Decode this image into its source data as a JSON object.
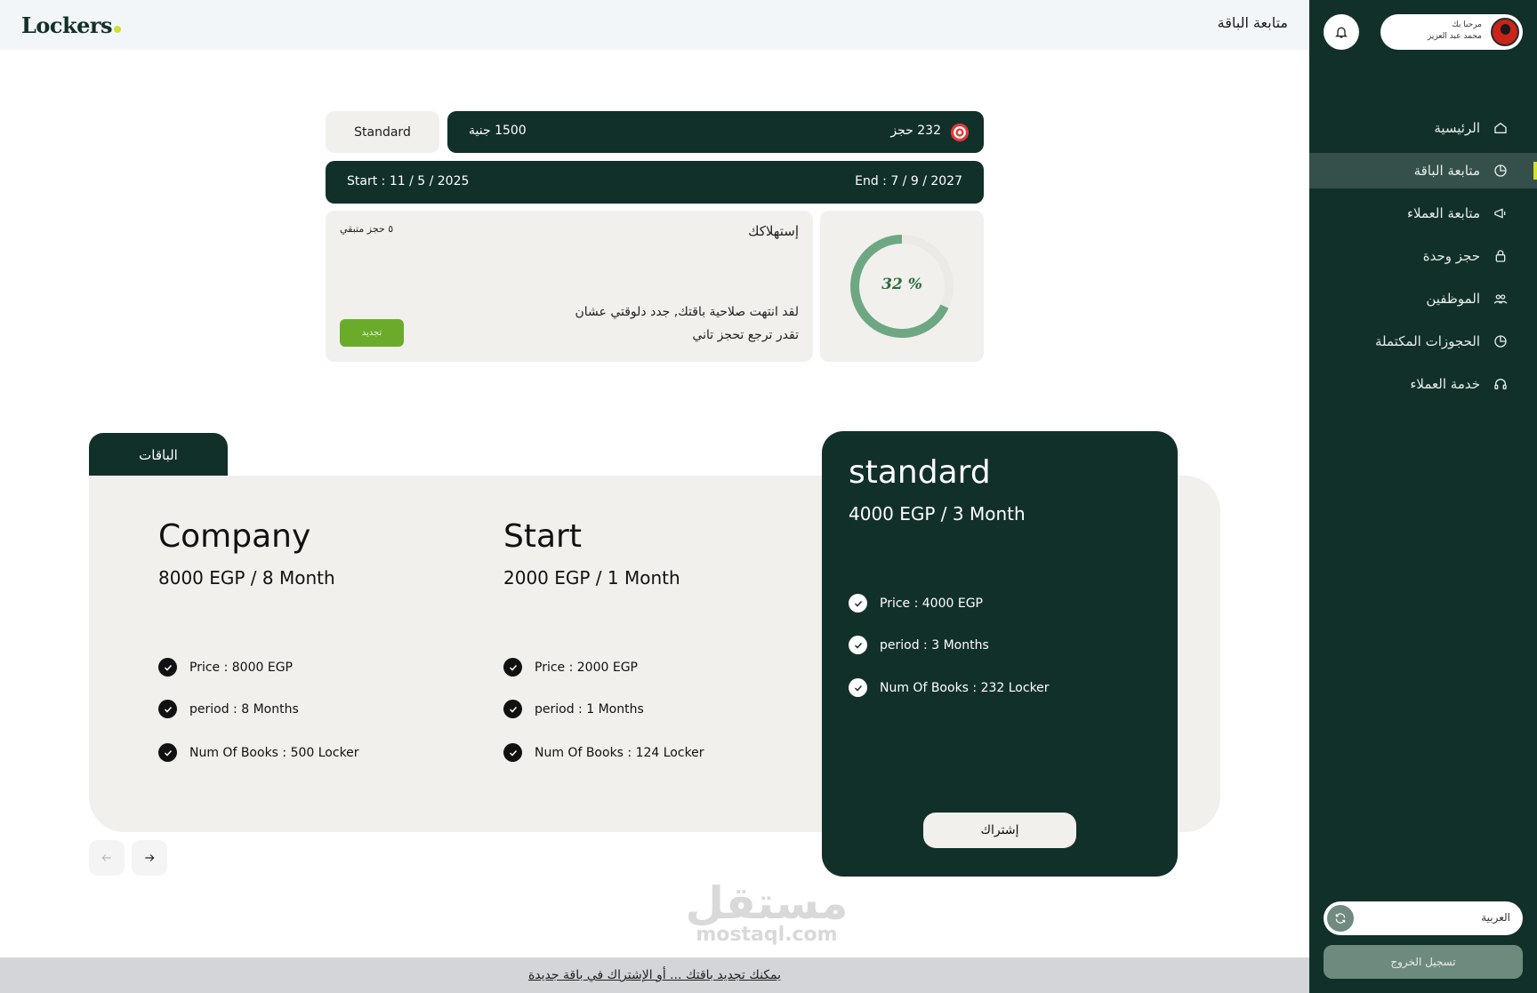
{
  "header": {
    "logo": "Lockers",
    "page_title": "متابعة الباقة"
  },
  "profile": {
    "greeting": "مرحبا بك",
    "name": "محمد عبد العزيز"
  },
  "sidebar": {
    "items": [
      {
        "label": "الرئيسية",
        "icon": "home-icon"
      },
      {
        "label": "متابعة الباقة",
        "icon": "pie-chart-icon",
        "active": true
      },
      {
        "label": "متابعة العملاء",
        "icon": "megaphone-icon"
      },
      {
        "label": "حجز وحدة",
        "icon": "lock-icon"
      },
      {
        "label": "الموظفين",
        "icon": "people-icon"
      },
      {
        "label": "الحجوزات المكتملة",
        "icon": "pie-chart-icon"
      },
      {
        "label": "خدمة العملاء",
        "icon": "headset-icon"
      }
    ],
    "language": "العربية",
    "logout": "تسجيل الخروج"
  },
  "subscription": {
    "plan": "Standard",
    "price": "1500 جنية",
    "bookings": "232 حجز",
    "start": "Start : 11 / 5 / 2025",
    "end": "End : 7 / 9 / 2027",
    "usage_title": "إستهلاكك",
    "remaining": "٥ حجز متبقي",
    "message_line1": "لقد انتهت صلاحية باقتك, جدد دلوقتي عشان",
    "message_line2": "تقدر ترجع تحجز تاني",
    "renew_label": "تجديد",
    "usage_percent_label": "32 %",
    "usage_fraction": 0.68
  },
  "packages": {
    "tab_label": "الباقات",
    "items": [
      {
        "name": "Company",
        "price": "8000 EGP / 8 Month",
        "features": [
          "Price : 8000 EGP",
          "period : 8 Months",
          "Num Of Books : 500 Locker"
        ]
      },
      {
        "name": "Start",
        "price": "2000 EGP / 1 Month",
        "features": [
          "Price : 2000 EGP",
          "period : 1 Months",
          "Num Of Books : 124 Locker"
        ]
      },
      {
        "name": "standard",
        "price": "4000 EGP / 3 Month",
        "features": [
          "Price : 4000 EGP",
          "period : 3 Months",
          "Num Of Books : 232 Locker"
        ]
      }
    ],
    "subscribe_label": "إشتراك"
  },
  "watermark": {
    "line1": "مستقل",
    "line2": "mostaql.com"
  },
  "footer": {
    "notice": "يمكنك تجديد باقتك ... أو الإشتراك في باقة جديدة"
  },
  "colors": {
    "primary": "#12302a",
    "accent": "#cfe12a",
    "renew": "#6aac2a",
    "ring": "#6ea883"
  }
}
